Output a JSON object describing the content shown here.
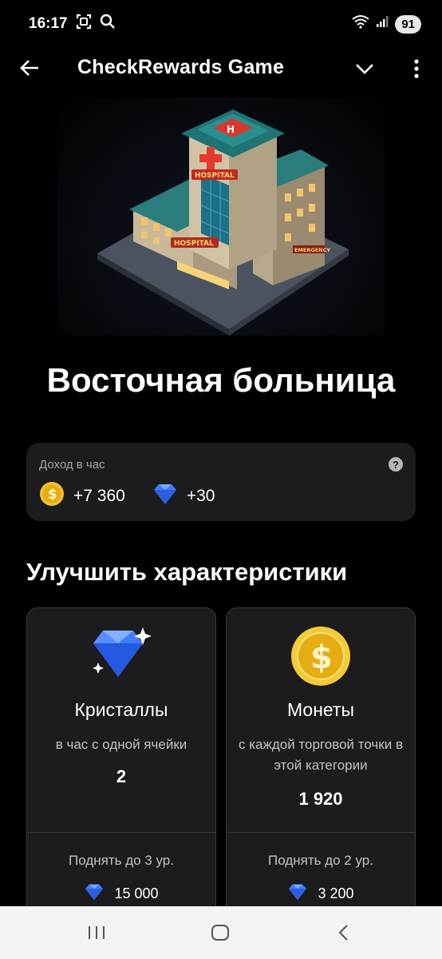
{
  "status_bar": {
    "time": "16:17",
    "battery": "91"
  },
  "app_bar": {
    "title": "CheckRewards Game"
  },
  "hero": {
    "image_name": "hospital-building"
  },
  "place": {
    "title": "Восточная больница"
  },
  "income": {
    "label": "Доход в час",
    "help": "?",
    "coins": "+7 360",
    "crystals": "+30"
  },
  "upgrades": {
    "title": "Улучшить характеристики",
    "cards": [
      {
        "name": "Кристаллы",
        "desc": "в час с одной ячейки",
        "value": "2",
        "upgrade_label": "Поднять до 3 ур.",
        "price": "15 000"
      },
      {
        "name": "Монеты",
        "desc": "с каждой торговой точки в этой категории",
        "value": "1 920",
        "upgrade_label": "Поднять до 2 ур.",
        "price": "3 200"
      }
    ]
  },
  "colors": {
    "accent_gem": "#3f7cff",
    "coin": "#f2c12e",
    "card_bg": "#1c1c1e"
  }
}
